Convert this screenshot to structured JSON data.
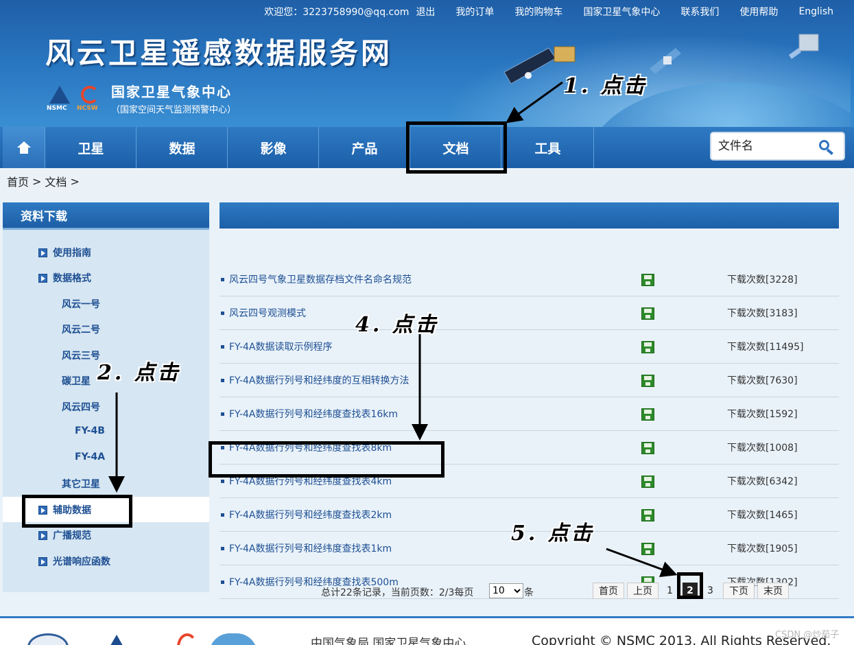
{
  "topnav": {
    "welcome": "欢迎您：3223758990@qq.com",
    "logout": "退出",
    "orders": "我的订单",
    "cart": "我的购物车",
    "center": "国家卫星气象中心",
    "contact": "联系我们",
    "help": "使用帮助",
    "english": "English"
  },
  "header": {
    "site_title": "风云卫星遥感数据服务网",
    "logo_left_label": "NSMC",
    "logo_right_label": "NCSW",
    "center_name": "国家卫星气象中心",
    "center_subname": "（国家空间天气监测预警中心）"
  },
  "mainnav": {
    "home_icon": "home-icon",
    "items": [
      "卫星",
      "数据",
      "影像",
      "产品",
      "文档",
      "工具"
    ],
    "active": "文档",
    "search_placeholder": "文件名"
  },
  "breadcrumb": [
    "首页",
    ">",
    "文档",
    ">"
  ],
  "sidebar": {
    "title": "资料下载",
    "items": [
      {
        "label": "使用指南",
        "level": 1
      },
      {
        "label": "数据格式",
        "level": 1
      },
      {
        "label": "风云一号",
        "level": 2
      },
      {
        "label": "风云二号",
        "level": 2
      },
      {
        "label": "风云三号",
        "level": 2
      },
      {
        "label": "碳卫星",
        "level": 2
      },
      {
        "label": "风云四号",
        "level": 2
      },
      {
        "label": "FY-4B",
        "level": 3
      },
      {
        "label": "FY-4A",
        "level": 3
      },
      {
        "label": "其它卫星",
        "level": 2
      },
      {
        "label": "辅助数据",
        "level": 1,
        "active": true
      },
      {
        "label": "广播规范",
        "level": 1
      },
      {
        "label": "光谱响应函数",
        "level": 1
      }
    ]
  },
  "documents": [
    {
      "title": "风云四号气象卫星数据存档文件名命名规范",
      "count": "下载次数[3228]"
    },
    {
      "title": "风云四号观测模式",
      "count": "下载次数[3183]"
    },
    {
      "title": "FY-4A数据读取示例程序",
      "count": "下载次数[11495]"
    },
    {
      "title": "FY-4A数据行列号和经纬度的互相转换方法",
      "count": "下载次数[7630]"
    },
    {
      "title": "FY-4A数据行列号和经纬度查找表16km",
      "count": "下载次数[1592]"
    },
    {
      "title": "FY-4A数据行列号和经纬度查找表8km",
      "count": "下载次数[1008]"
    },
    {
      "title": "FY-4A数据行列号和经纬度查找表4km",
      "count": "下载次数[6342]"
    },
    {
      "title": "FY-4A数据行列号和经纬度查找表2km",
      "count": "下载次数[1465]"
    },
    {
      "title": "FY-4A数据行列号和经纬度查找表1km",
      "count": "下载次数[1905]"
    },
    {
      "title": "FY-4A数据行列号和经纬度查找表500m",
      "count": "下载次数[1302]"
    }
  ],
  "pager": {
    "summary": "总计22条记录，当前页数：2/3每页",
    "page_size": "10",
    "suffix": "条",
    "first": "首页",
    "prev": "上页",
    "pages": [
      "1",
      "2",
      "3"
    ],
    "current": "2",
    "next": "下页",
    "last": "末页"
  },
  "footer": {
    "org": "中国气象局 国家卫星气象中心",
    "copyright": "Copyright © NSMC 2013. All Rights Reserved.",
    "watermark": "CSDN @炒茄子"
  },
  "annotations": [
    "1. 点击",
    "2. 点击",
    "4. 点击",
    "5. 点击"
  ],
  "colors": {
    "nav_blue": "#1b5ea8",
    "link_blue": "#1e4f93",
    "panel_bg": "#e9f2f9",
    "annotation": "#000000",
    "download_icon": "#2d8a2a"
  }
}
